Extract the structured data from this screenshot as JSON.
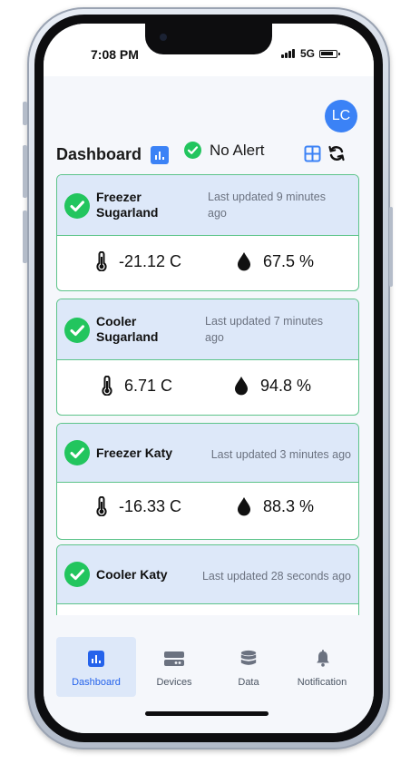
{
  "status_bar": {
    "time": "7:08 PM",
    "network": "5G"
  },
  "avatar": {
    "initials": "LC"
  },
  "header": {
    "title": "Dashboard",
    "alert_status": "No Alert"
  },
  "devices": [
    {
      "name": "Freezer Sugarland",
      "updated": "Last updated 9 minutes ago",
      "temperature": "-21.12 C",
      "humidity": "67.5 %"
    },
    {
      "name": "Cooler Sugarland",
      "updated": "Last updated 7 minutes ago",
      "temperature": "6.71 C",
      "humidity": "94.8 %"
    },
    {
      "name": "Freezer Katy",
      "updated": "Last updated 3 minutes ago",
      "temperature": "-16.33 C",
      "humidity": "88.3 %"
    },
    {
      "name": "Cooler Katy",
      "updated": "Last updated 28 seconds ago",
      "temperature": "",
      "humidity": ""
    }
  ],
  "tabs": [
    {
      "label": "Dashboard",
      "icon": "chart-icon",
      "active": true
    },
    {
      "label": "Devices",
      "icon": "device-icon",
      "active": false
    },
    {
      "label": "Data",
      "icon": "database-icon",
      "active": false
    },
    {
      "label": "Notification",
      "icon": "bell-icon",
      "active": false
    }
  ],
  "colors": {
    "accent": "#3b82f6",
    "ok": "#22c55e",
    "card_border": "#5dc48a",
    "card_header": "#dde8f9"
  }
}
